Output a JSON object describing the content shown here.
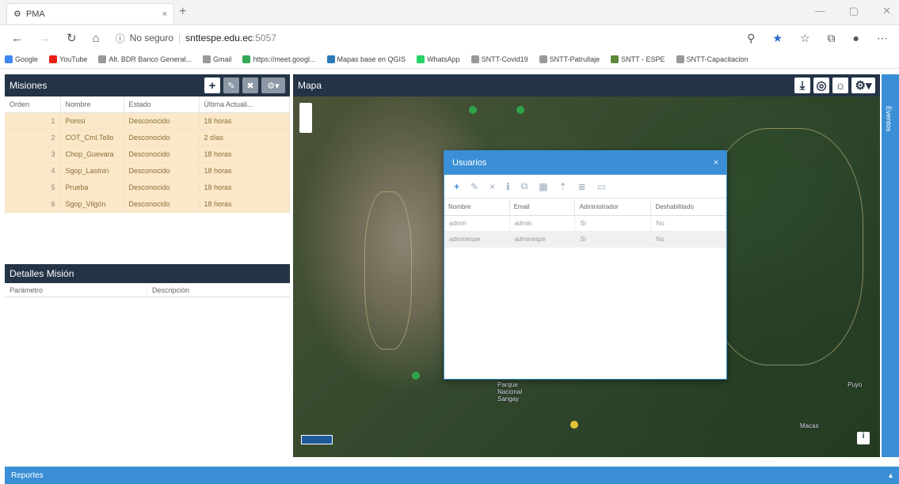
{
  "browser": {
    "tab_title": "PMA",
    "tab_close": "×",
    "new_tab": "+",
    "window_controls": [
      "—",
      "▢",
      "✕"
    ],
    "security": "No seguro",
    "url_host": "snttespe.edu.ec",
    "url_port": ":5057",
    "bookmarks": [
      {
        "label": "Google",
        "color": "#4285f4"
      },
      {
        "label": "YouTube",
        "color": "#e62117"
      },
      {
        "label": "Alt. BDR Banco General...",
        "color": "#999"
      },
      {
        "label": "Gmail",
        "color": "#999"
      },
      {
        "label": "https://meet.googl...",
        "color": "#34a853"
      },
      {
        "label": "Mapas base en QGIS",
        "color": "#2a7ab8"
      },
      {
        "label": "WhatsApp",
        "color": "#25d366"
      },
      {
        "label": "SNTT-Covid19",
        "color": "#999"
      },
      {
        "label": "SNTT-Patrullaje",
        "color": "#999"
      },
      {
        "label": "SNTT - ESPE",
        "color": "#5a8a3a"
      },
      {
        "label": "SNTT-Capacitacion",
        "color": "#999"
      }
    ]
  },
  "misiones": {
    "title": "Misiones",
    "add": "+",
    "columns": [
      "Orden",
      "Nombre",
      "Estado",
      "Última Actuali..."
    ],
    "rows": [
      {
        "orden": "1",
        "nombre": "Pomsi",
        "estado": "Desconocido",
        "ultima": "18 horas"
      },
      {
        "orden": "2",
        "nombre": "COT_Cml.Tello",
        "estado": "Desconocido",
        "ultima": "2 días"
      },
      {
        "orden": "3",
        "nombre": "Chop_Guevara",
        "estado": "Desconocido",
        "ultima": "18 horas"
      },
      {
        "orden": "4",
        "nombre": "Sgop_Lastnin",
        "estado": "Desconocido",
        "ultima": "18 horas"
      },
      {
        "orden": "5",
        "nombre": "Prueba",
        "estado": "Desconocido",
        "ultima": "18 horas"
      },
      {
        "orden": "6",
        "nombre": "Sgop_Vilgón",
        "estado": "Desconocido",
        "ultima": "18 horas"
      }
    ]
  },
  "detalles": {
    "title": "Detalles Misión",
    "columns": [
      "Parámetro",
      "Descripción"
    ]
  },
  "mapa": {
    "title": "Mapa",
    "labels": [
      "Parque Nacional Sangay",
      "Puyo",
      "Macas"
    ],
    "side_tab": "Eventos"
  },
  "usuarios": {
    "title": "Usuarios",
    "close": "×",
    "columns": [
      "Nombre",
      "Email",
      "Administrador",
      "Deshabilitado"
    ],
    "rows": [
      {
        "nombre": "admin",
        "email": "admin",
        "admin": "Sí",
        "des": "No"
      },
      {
        "nombre": "adminespe",
        "email": "adminespe",
        "admin": "Sí",
        "des": "No"
      }
    ]
  },
  "reportes": {
    "title": "Reportes"
  }
}
